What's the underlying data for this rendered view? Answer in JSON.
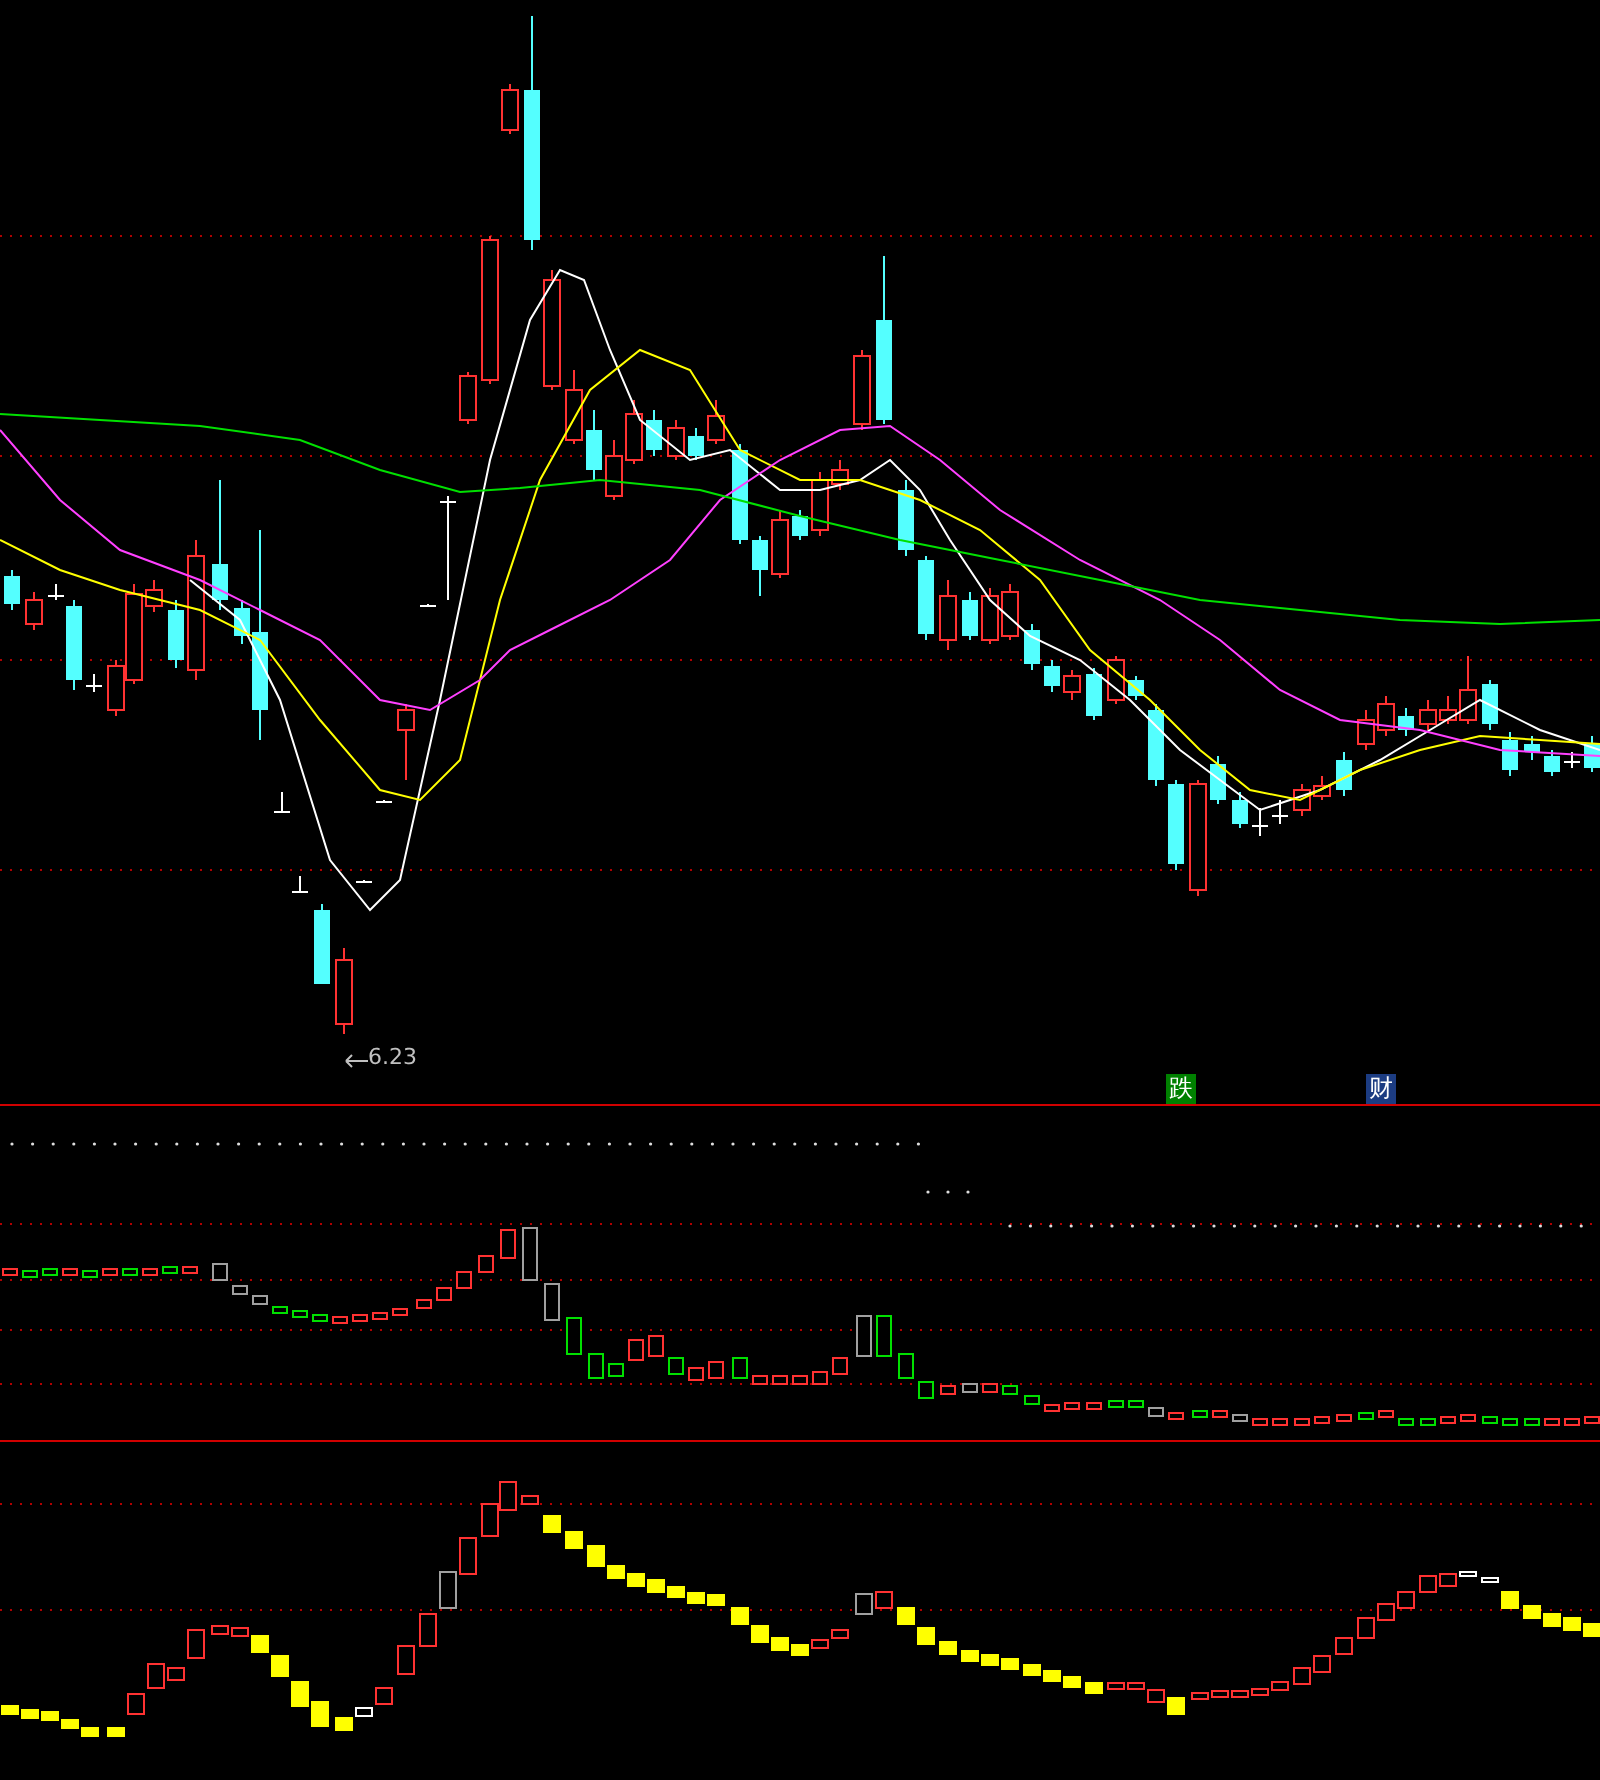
{
  "main_chart": {
    "low_price_label": "6.23",
    "signal_badges": [
      {
        "text": "跌",
        "color": "#008000"
      },
      {
        "text": "财",
        "color": "#1c3c82"
      }
    ]
  }
}
